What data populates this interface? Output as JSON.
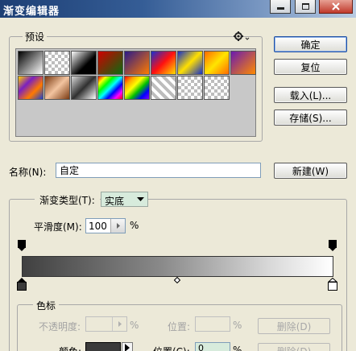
{
  "window": {
    "title": "渐变编辑器"
  },
  "colors": {
    "title_start": "#1d3f74",
    "title_end": "#b9cbe2",
    "dialog_bg": "#ece9d8"
  },
  "presets": {
    "label": "预设",
    "menu_icon": "gear-icon",
    "swatches": [
      {
        "name": "black-white",
        "css": "linear-gradient(135deg,#000,#fff)"
      },
      {
        "name": "fg-transparent",
        "css": "checker"
      },
      {
        "name": "black-white-2",
        "css": "linear-gradient(135deg,#fff 0%,#000 60%)"
      },
      {
        "name": "red-green",
        "css": "linear-gradient(135deg,#d00000,#0a6b10)"
      },
      {
        "name": "violet-orange",
        "css": "linear-gradient(135deg,#2a1a8a,#ff7a00)"
      },
      {
        "name": "blue-red-yellow",
        "css": "linear-gradient(135deg,#1a2fd0,#ff1010,#ffe000)"
      },
      {
        "name": "blue-yellow-blue",
        "css": "linear-gradient(135deg,#1630c8,#ffe000,#1630c8)"
      },
      {
        "name": "orange-yellow-orange",
        "css": "linear-gradient(135deg,#ff6a00,#ffe400,#ff6a00)"
      },
      {
        "name": "violet-green-orange",
        "css": "linear-gradient(135deg,#6a1ab0,#ff8a00)"
      },
      {
        "name": "yellow-violet-orange-blue",
        "css": "linear-gradient(135deg,#ffcc00,#7a20c0,#ff7a00,#1a40d0)"
      },
      {
        "name": "copper",
        "css": "linear-gradient(135deg,#7a3a12,#f2c4a0,#7a3a12)"
      },
      {
        "name": "chrome",
        "css": "linear-gradient(135deg,#d8d8d8,#303030,#ffffff)"
      },
      {
        "name": "spectrum",
        "css": "linear-gradient(135deg,#ff0000,#ffff00,#00ff00,#00ffff,#0000ff,#ff00ff,#ff0000)"
      },
      {
        "name": "transparent-rainbow",
        "css": "linear-gradient(135deg,#ff0000,#ffa500,#ffff00,#00c000,#0000ff,#8000ff)"
      },
      {
        "name": "transparent-stripes",
        "css": "repeating-linear-gradient(45deg,#ffffff 0 4px,#bdbdbd 4px 8px)"
      },
      {
        "name": "checker-2",
        "css": "checker"
      },
      {
        "name": "checker-3",
        "css": "checker"
      }
    ]
  },
  "buttons": {
    "ok": "确定",
    "reset": "复位",
    "load": "载入(L)...",
    "save": "存储(S)...",
    "new": "新建(W)",
    "delete1": "删除(D)",
    "delete2": "删除(D)"
  },
  "name_field": {
    "label": "名称(N):",
    "value": "自定"
  },
  "gradient_type": {
    "label": "渐变类型(T):",
    "value": "实底"
  },
  "smoothness": {
    "label": "平滑度(M):",
    "value": "100",
    "unit": "%"
  },
  "stops": {
    "group_label": "色标",
    "opacity_label": "不透明度:",
    "opacity_unit": "%",
    "location_label1": "位置:",
    "location_unit1": "%",
    "color_label": "颜色:",
    "location_label2": "位置(C):",
    "location_value2": "0",
    "location_unit2": "%"
  }
}
